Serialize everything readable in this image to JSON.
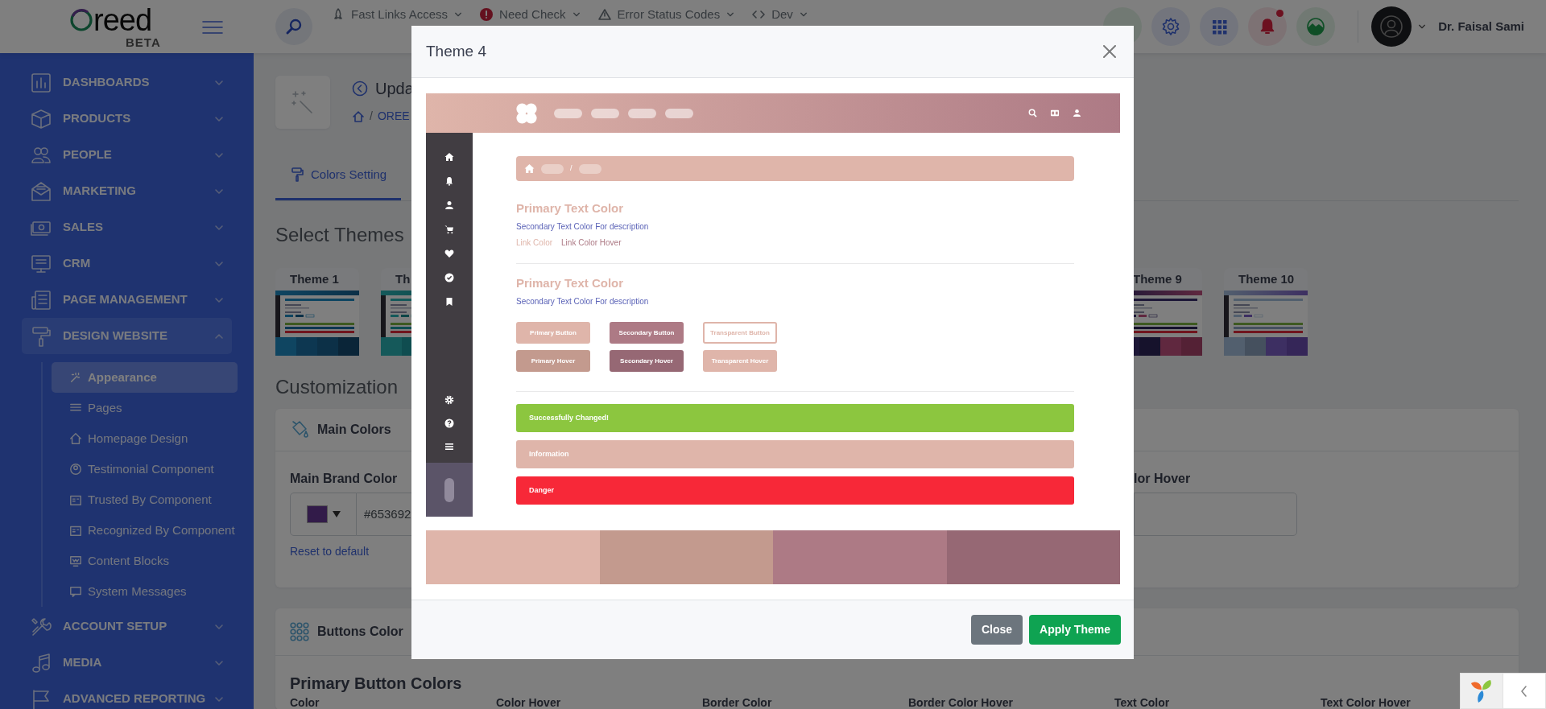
{
  "topbar": {
    "logo": {
      "wordmark": "reed",
      "tag": "BETA"
    },
    "quick_links": [
      {
        "label": "Fast Links Access"
      },
      {
        "label": "Need Check"
      },
      {
        "label": "Error Status Codes"
      },
      {
        "label": "Dev"
      }
    ],
    "notifications": {
      "unread": true
    },
    "user": {
      "name": "Dr. Faisal Sami"
    }
  },
  "sidebar": {
    "items": [
      {
        "label": "DASHBOARDS",
        "expanded": false
      },
      {
        "label": "PRODUCTS",
        "expanded": false
      },
      {
        "label": "PEOPLE",
        "expanded": false
      },
      {
        "label": "MARKETING",
        "expanded": false
      },
      {
        "label": "SALES",
        "expanded": false
      },
      {
        "label": "CRM",
        "expanded": false
      },
      {
        "label": "PAGE MANAGEMENT",
        "expanded": false
      },
      {
        "label": "DESIGN WEBSITE",
        "expanded": true,
        "children": [
          {
            "label": "Appearance",
            "selected": true
          },
          {
            "label": "Pages",
            "selected": false
          },
          {
            "label": "Homepage Design",
            "selected": false
          },
          {
            "label": "Testimonial Component",
            "selected": false
          },
          {
            "label": "Trusted By Component",
            "selected": false
          },
          {
            "label": "Recognized By Component",
            "selected": false
          },
          {
            "label": "Content Blocks",
            "selected": false
          },
          {
            "label": "System Messages",
            "selected": false
          }
        ]
      },
      {
        "label": "ACCOUNT SETUP",
        "expanded": false
      },
      {
        "label": "MEDIA",
        "expanded": false
      },
      {
        "label": "ADVANCED REPORTING",
        "expanded": false
      }
    ]
  },
  "page": {
    "title": "Upda",
    "breadcrumb": {
      "separator": "/",
      "items": [
        "OREE"
      ]
    }
  },
  "tabs": [
    {
      "label": "Colors Setting",
      "selected": true
    }
  ],
  "themes_section": {
    "heading": "Select Themes",
    "themes": [
      {
        "label": "Theme 1"
      },
      {
        "label": "Th"
      },
      {
        "label": "Theme 9"
      },
      {
        "label": "Theme 10"
      }
    ]
  },
  "customization": {
    "heading": "Customization",
    "main_colors": {
      "title": "Main Colors",
      "fields": [
        {
          "label": "Main Brand Color",
          "value": "#653692",
          "reset": "Reset to default"
        },
        {
          "label": "lor Hover"
        }
      ]
    },
    "buttons_color": {
      "title": "Buttons Color",
      "subheading": "Primary Button Colors",
      "columns": [
        "Color",
        "Color Hover",
        "Border Color",
        "Border Color Hover",
        "Text Color",
        "Text Color Hover"
      ]
    }
  },
  "modal": {
    "title": "Theme 4",
    "preview": {
      "breadcrumb_separator": "/",
      "sections": [
        {
          "heading": "Primary Text Color",
          "description": "Secondary Text Color For description",
          "links": [
            {
              "label": "Link Color",
              "hover": false
            },
            {
              "label": "Link Color Hover",
              "hover": true
            }
          ]
        },
        {
          "heading": "Primary Text Color",
          "description": "Secondary Text Color For description",
          "buttons": [
            {
              "label": "Primary Button",
              "kind": "primary",
              "hover": false
            },
            {
              "label": "Secondary Button",
              "kind": "secondary",
              "hover": false
            },
            {
              "label": "Transparent Button",
              "kind": "transparent",
              "hover": false
            },
            {
              "label": "Primary Hover",
              "kind": "primary",
              "hover": true
            },
            {
              "label": "Secondary Hover",
              "kind": "secondary",
              "hover": true
            },
            {
              "label": "Transparent Hover",
              "kind": "transparent",
              "hover": true
            }
          ]
        }
      ],
      "alerts": [
        {
          "label": "Successfully Changed!",
          "kind": "success"
        },
        {
          "label": "Information",
          "kind": "info"
        },
        {
          "label": "Danger",
          "kind": "danger"
        }
      ]
    },
    "palette": [
      {
        "color": "#dfb5aa"
      },
      {
        "color": "#c39a8e"
      },
      {
        "color": "#ad7a85"
      },
      {
        "color": "#966874"
      }
    ],
    "buttons": [
      {
        "label": "Close",
        "kind": "secondary"
      },
      {
        "label": "Apply Theme",
        "kind": "success"
      }
    ]
  }
}
